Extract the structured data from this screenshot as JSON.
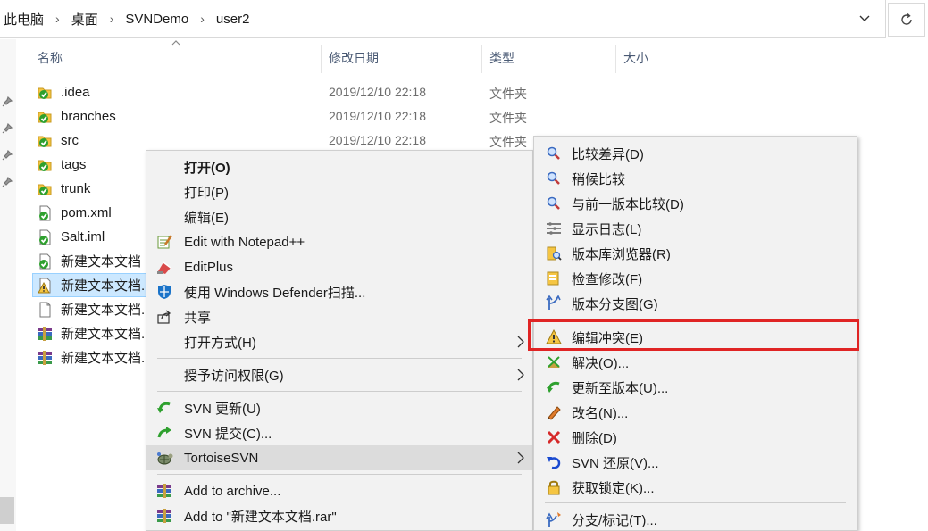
{
  "breadcrumb": [
    "此电脑",
    "桌面",
    "SVNDemo",
    "user2"
  ],
  "columns": {
    "name": "名称",
    "modified": "修改日期",
    "type": "类型",
    "size": "大小"
  },
  "files": [
    {
      "name": ".idea",
      "date": "2019/12/10 22:18",
      "type": "文件夹",
      "icon": "svn-folder-ok-icon"
    },
    {
      "name": "branches",
      "date": "2019/12/10 22:18",
      "type": "文件夹",
      "icon": "svn-folder-ok-icon"
    },
    {
      "name": "src",
      "date": "2019/12/10 22:18",
      "type": "文件夹",
      "icon": "svn-folder-ok-icon"
    },
    {
      "name": "tags",
      "date": "",
      "type": "",
      "icon": "svn-folder-ok-icon"
    },
    {
      "name": "trunk",
      "date": "",
      "type": "",
      "icon": "svn-folder-ok-icon"
    },
    {
      "name": "pom.xml",
      "date": "",
      "type": "",
      "icon": "svn-file-ok-icon"
    },
    {
      "name": "Salt.iml",
      "date": "",
      "type": "",
      "icon": "svn-file-ok-icon"
    },
    {
      "name": "新建文本文档",
      "date": "",
      "type": "",
      "icon": "svn-file-ok-icon"
    },
    {
      "name": "新建文本文档.",
      "date": "",
      "type": "",
      "icon": "svn-file-conflict-icon",
      "selected": true
    },
    {
      "name": "新建文本文档.",
      "date": "",
      "type": "",
      "icon": "text-file-icon"
    },
    {
      "name": "新建文本文档.",
      "date": "",
      "type": "",
      "icon": "winrar-icon"
    },
    {
      "name": "新建文本文档.",
      "date": "",
      "type": "",
      "icon": "winrar-icon"
    }
  ],
  "context_menu": {
    "open": "打开(O)",
    "print": "打印(P)",
    "edit": "编辑(E)",
    "notepadpp": "Edit with Notepad++",
    "editplus": "EditPlus",
    "defender": "使用 Windows Defender扫描...",
    "share": "共享",
    "open_with": "打开方式(H)",
    "grant_access": "授予访问权限(G)",
    "svn_update": "SVN 更新(U)",
    "svn_commit": "SVN 提交(C)...",
    "tortoise": "TortoiseSVN",
    "add_archive": "Add to archive...",
    "add_rar": "Add to \"新建文本文档.rar\""
  },
  "submenu": {
    "diff": "比较差异(D)",
    "diff_later": "稍候比较",
    "diff_prev": "与前一版本比较(D)",
    "show_log": "显示日志(L)",
    "repo_browser": "版本库浏览器(R)",
    "check_mod": "检查修改(F)",
    "rev_graph": "版本分支图(G)",
    "edit_conflicts": "编辑冲突(E)",
    "resolve": "解决(O)...",
    "update_rev": "更新至版本(U)...",
    "rename": "改名(N)...",
    "delete": "删除(D)",
    "revert": "SVN 还原(V)...",
    "get_lock": "获取锁定(K)...",
    "branch_tag": "分支/标记(T)..."
  },
  "colors": {
    "highlight": "#e02424",
    "selection": "#cce8ff",
    "svn_ok": "#2ea02e",
    "folder": "#f5c542"
  }
}
